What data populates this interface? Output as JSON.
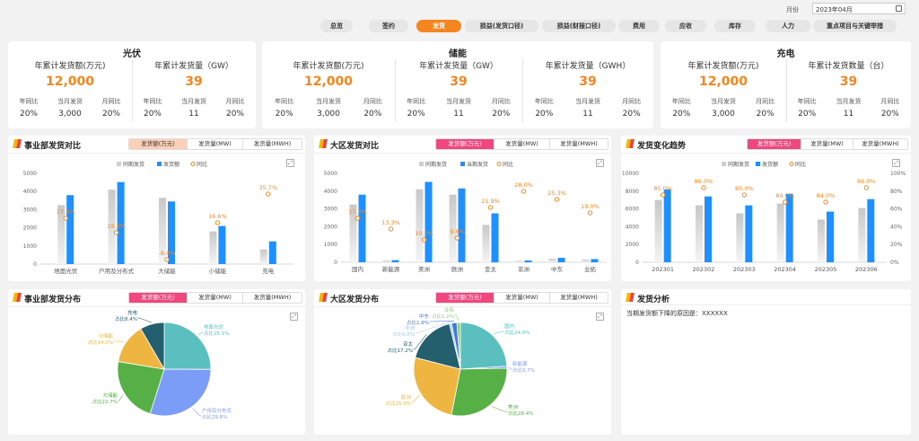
{
  "header": {
    "month_label": "月份",
    "month_value": "2023年04月"
  },
  "tabs": [
    {
      "label": "总览",
      "active": false
    },
    {
      "label": "签约",
      "active": false
    },
    {
      "label": "发货",
      "active": true
    },
    {
      "label": "损益(发货口径)",
      "active": false
    },
    {
      "label": "损益(财报口径)",
      "active": false
    },
    {
      "label": "费用",
      "active": false
    },
    {
      "label": "应收",
      "active": false
    },
    {
      "label": "库存",
      "active": false
    },
    {
      "label": "人力",
      "active": false
    },
    {
      "label": "重点项目与关键举措",
      "active": false
    }
  ],
  "kpi_sections": [
    {
      "title": "光伏",
      "groups": [
        {
          "label": "年累计发货额(万元)",
          "value": "12,000",
          "minis": [
            {
              "label": "年同比",
              "value": "20%"
            },
            {
              "label": "当月发货",
              "value": "3,000"
            },
            {
              "label": "月同比",
              "value": "20%"
            }
          ]
        },
        {
          "label": "年累计发货量（GW）",
          "value": "39",
          "minis": [
            {
              "label": "年同比",
              "value": "20%"
            },
            {
              "label": "当月发货",
              "value": "11"
            },
            {
              "label": "月同比",
              "value": "20%"
            }
          ]
        }
      ]
    },
    {
      "title": "储能",
      "groups": [
        {
          "label": "年累计发货额(万元)",
          "value": "12,000",
          "minis": [
            {
              "label": "年同比",
              "value": "20%"
            },
            {
              "label": "当月发货",
              "value": "3,000"
            },
            {
              "label": "月同比",
              "value": "20%"
            }
          ]
        },
        {
          "label": "年累计发货量（GW）",
          "value": "39",
          "minis": [
            {
              "label": "年同比",
              "value": "20%"
            },
            {
              "label": "当月发货",
              "value": "11"
            },
            {
              "label": "月同比",
              "value": "20%"
            }
          ]
        },
        {
          "label": "年累计发货量（GWH）",
          "value": "39",
          "minis": [
            {
              "label": "年同比",
              "value": "20%"
            },
            {
              "label": "当月发货",
              "value": "11"
            },
            {
              "label": "月同比",
              "value": "20%"
            }
          ]
        }
      ]
    },
    {
      "title": "充电",
      "groups": [
        {
          "label": "年累计发货额(万元)",
          "value": "12,000",
          "minis": [
            {
              "label": "年同比",
              "value": "20%"
            },
            {
              "label": "当月发货",
              "value": "3,000"
            },
            {
              "label": "月同比",
              "value": "20%"
            }
          ]
        },
        {
          "label": "年累计发货数量（台）",
          "value": "39",
          "minis": [
            {
              "label": "年同比",
              "value": "20%"
            },
            {
              "label": "当月发货",
              "value": "11"
            },
            {
              "label": "月同比",
              "value": "20%"
            }
          ]
        }
      ]
    }
  ],
  "seg_labels": [
    "发货额(万元)",
    "发货量(MW)",
    "发货量(MWH)"
  ],
  "panels": {
    "p1": {
      "title": "事业部发货对比"
    },
    "p2": {
      "title": "大区发货对比"
    },
    "p3": {
      "title": "发货变化趋势"
    },
    "p4": {
      "title": "事业部发货分布"
    },
    "p5": {
      "title": "大区发货分布"
    },
    "p6": {
      "title": "发货分析",
      "text": "当期发货额下降的原因是：XXXXXX"
    }
  },
  "legend": {
    "prev": "同期发货",
    "cur": "发货额",
    "cur2": "当期发货",
    "yoy": "同比"
  },
  "colors": {
    "prev": "#d9d9d9",
    "cur": "#1e90ff",
    "yoy": "#f5861f",
    "accent": "#f5861f",
    "pink": "#f0477f"
  },
  "chart_data": [
    {
      "type": "bar",
      "id": "division",
      "categories": [
        "地面光伏",
        "户用及分布式",
        "大储能",
        "小储能",
        "充电"
      ],
      "series": [
        {
          "name": "同期发货",
          "values": [
            3250,
            4100,
            3650,
            1800,
            800
          ]
        },
        {
          "name": "发货额",
          "values": [
            3800,
            4520,
            3450,
            2100,
            1250
          ]
        }
      ],
      "yoy": {
        "name": "同比",
        "values": [
          17.3,
          10.3,
          -8.0,
          16.6,
          35.7
        ]
      },
      "ylim": [
        0,
        5000
      ],
      "yticks": [
        0,
        1000,
        2000,
        3000,
        4000,
        5000
      ]
    },
    {
      "type": "bar",
      "id": "region",
      "categories": [
        "国内",
        "新能源",
        "美洲",
        "欧洲",
        "亚太",
        "非洲",
        "中东",
        "业拓"
      ],
      "series": [
        {
          "name": "同期发货",
          "values": [
            3250,
            100,
            4100,
            3800,
            2100,
            80,
            200,
            150
          ]
        },
        {
          "name": "当期发货",
          "values": [
            3800,
            120,
            4520,
            4150,
            2750,
            100,
            250,
            180
          ]
        }
      ],
      "yoy": {
        "name": "同比",
        "values": [
          17.3,
          13.3,
          10.3,
          9.6,
          21.9,
          28.0,
          25.3,
          19.0
        ]
      },
      "ylim": [
        0,
        5000
      ],
      "yticks": [
        0,
        1000,
        2000,
        3000,
        4000,
        5000
      ]
    },
    {
      "type": "bar",
      "id": "trend",
      "categories": [
        "202301",
        "202302",
        "202303",
        "202304",
        "202305",
        "202306"
      ],
      "series": [
        {
          "name": "同期发货",
          "values": [
            7000,
            6400,
            5500,
            6600,
            4800,
            6100
          ]
        },
        {
          "name": "发货额",
          "values": [
            8200,
            7400,
            6400,
            7700,
            5700,
            7100
          ]
        }
      ],
      "yoy": {
        "name": "同比",
        "values": [
          85.0,
          86.0,
          85.0,
          84.0,
          84.0,
          86.0
        ]
      },
      "ylim": [
        0,
        10000
      ],
      "yticks": [
        0,
        2000,
        4000,
        6000,
        8000,
        10000
      ],
      "y2lim": [
        0,
        100
      ],
      "y2ticks": [
        "0%",
        "20%",
        "40%",
        "60%",
        "80%",
        "100%"
      ]
    },
    {
      "type": "pie",
      "id": "division-pie",
      "slices": [
        {
          "label": "地面光伏",
          "pct": 25.1,
          "color": "#5bbfc0"
        },
        {
          "label": "户用及分布式",
          "pct": 29.8,
          "color": "#7b9cf7"
        },
        {
          "label": "大储能",
          "pct": 22.7,
          "color": "#56b046"
        },
        {
          "label": "小储能",
          "pct": 14.0,
          "color": "#eeb640"
        },
        {
          "label": "充电",
          "pct": 8.4,
          "color": "#245f6e"
        }
      ]
    },
    {
      "type": "pie",
      "id": "region-pie",
      "slices": [
        {
          "label": "国内",
          "pct": 24.0,
          "color": "#5bbfc0"
        },
        {
          "label": "新能源",
          "pct": 0.7,
          "color": "#7b9cf7"
        },
        {
          "label": "美洲",
          "pct": 28.4,
          "color": "#56b046"
        },
        {
          "label": "欧洲",
          "pct": 25.9,
          "color": "#eeb640"
        },
        {
          "label": "亚太",
          "pct": 17.2,
          "color": "#245f6e"
        },
        {
          "label": "非洲",
          "pct": 0.8,
          "color": "#a4c8f0"
        },
        {
          "label": "中东",
          "pct": 1.8,
          "color": "#3e7ad8"
        },
        {
          "label": "业拓",
          "pct": 1.2,
          "color": "#8fd07a"
        }
      ]
    }
  ],
  "pie_prefix": "占比"
}
